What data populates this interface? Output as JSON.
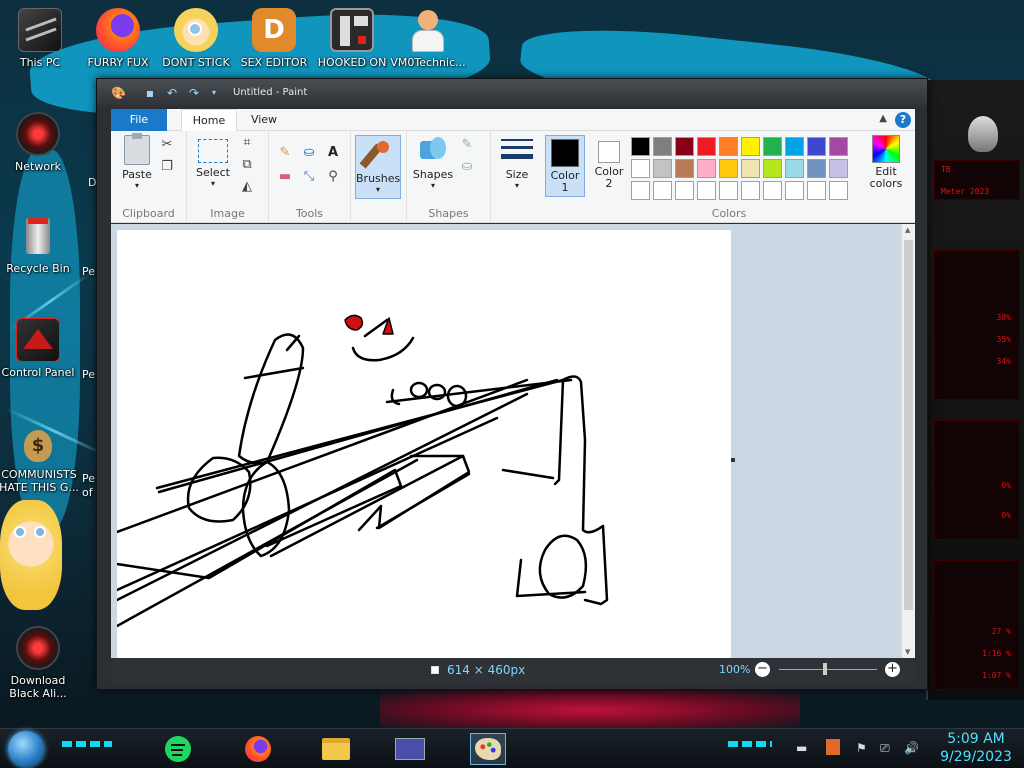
{
  "desktop": {
    "icons": [
      {
        "label": "This PC"
      },
      {
        "label": "FURRY FUX"
      },
      {
        "label": "DONT STICK"
      },
      {
        "label": "SEX EDITOR"
      },
      {
        "label": "HOOKED ON"
      },
      {
        "label": "VM0Technic..."
      },
      {
        "label": "Network"
      },
      {
        "label": "Recycle Bin"
      },
      {
        "label": "Control Panel"
      },
      {
        "label": "COMMUNISTS HATE THIS G..."
      },
      {
        "label": "Download Black Ali..."
      }
    ],
    "partial_labels": [
      "Pe",
      "Pe",
      "Pe",
      "of",
      "D"
    ],
    "alien_panel": {
      "rows": [
        "TB",
        "Meter 2023",
        "38%",
        "35%",
        "34%",
        "0%",
        "0%",
        "27 %",
        "1:16 %",
        "1:07 %"
      ]
    }
  },
  "paint": {
    "title": "Untitled - Paint",
    "tabs": {
      "file": "File",
      "home": "Home",
      "view": "View"
    },
    "groups": {
      "clipboard": {
        "label": "Clipboard",
        "paste": "Paste"
      },
      "image": {
        "label": "Image",
        "select": "Select"
      },
      "tools": {
        "label": "Tools"
      },
      "brushes": {
        "label": "Brushes"
      },
      "shapes": {
        "label": "Shapes",
        "button": "Shapes"
      },
      "size": {
        "label": "Size"
      },
      "colors": {
        "label": "Colors",
        "color1": "Color 1",
        "color2": "Color 2",
        "edit": "Edit colors"
      }
    },
    "palette": {
      "row1": [
        "#000000",
        "#7f7f7f",
        "#880015",
        "#ed1c24",
        "#ff7f27",
        "#fff200",
        "#22b14c",
        "#00a2e8",
        "#3f48cc",
        "#a349a4"
      ],
      "row2": [
        "#ffffff",
        "#c3c3c3",
        "#b97a57",
        "#ffaec9",
        "#ffc90e",
        "#efe4b0",
        "#b5e61d",
        "#99d9ea",
        "#7092be",
        "#c8bfe7"
      ]
    },
    "color1_value": "#000000",
    "color2_value": "#ffffff",
    "status": {
      "dimensions": "614 × 460px",
      "zoom": "100%"
    }
  },
  "taskbar": {
    "time": "5:09 AM",
    "date": "9/29/2023"
  }
}
